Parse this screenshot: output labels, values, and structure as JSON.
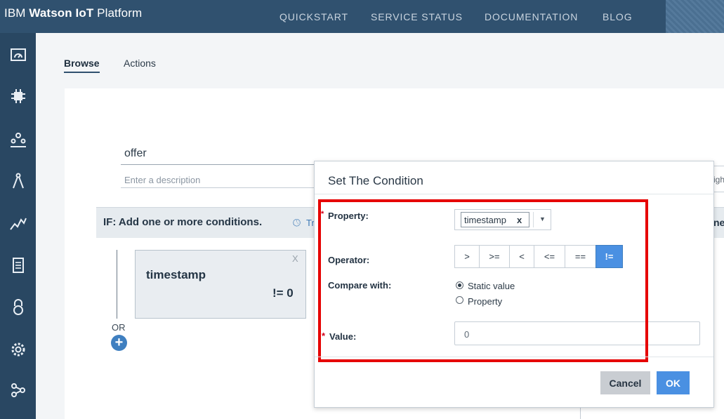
{
  "header": {
    "brand_prefix": "IBM ",
    "brand_bold": "Watson IoT",
    "brand_suffix": " Platform",
    "nav": [
      "QUICKSTART",
      "SERVICE STATUS",
      "DOCUMENTATION",
      "BLOG"
    ]
  },
  "sidebar": {
    "icons": [
      "dashboard-icon",
      "devices-chip-icon",
      "members-icon",
      "rules-compass-icon",
      "usage-chart-icon",
      "logs-document-icon",
      "security-lock-icon",
      "settings-gear-icon",
      "extensions-nodes-icon"
    ]
  },
  "tabs": {
    "browse": "Browse",
    "actions": "Actions"
  },
  "rule": {
    "name": "offer",
    "description_placeholder": "Enter a description",
    "right_field_partial": "igh"
  },
  "if_bar": {
    "title": "IF: Add one or more conditions.",
    "trigger_partial": "Tr",
    "right_partial": "ne"
  },
  "condition_card": {
    "close": "X",
    "property": "timestamp",
    "expression": "!= 0"
  },
  "or_label": "OR",
  "add_symbol": "+",
  "dialog": {
    "title": "Set The Condition",
    "required_mark": "*",
    "property_label": "Property:",
    "property_value": "timestamp",
    "property_remove": "x",
    "operator_label": "Operator:",
    "operators": [
      ">",
      ">=",
      "<",
      "<=",
      "==",
      "!="
    ],
    "selected_operator": "!=",
    "compare_label": "Compare with:",
    "compare_options": [
      "Static value",
      "Property"
    ],
    "compare_selected": "Static value",
    "value_label": "Value:",
    "value": "0",
    "cancel": "Cancel",
    "ok": "OK"
  },
  "colors": {
    "topbar": "#30516f",
    "sidebar": "#294762",
    "accent": "#4a90e2",
    "highlight": "#e60000"
  }
}
